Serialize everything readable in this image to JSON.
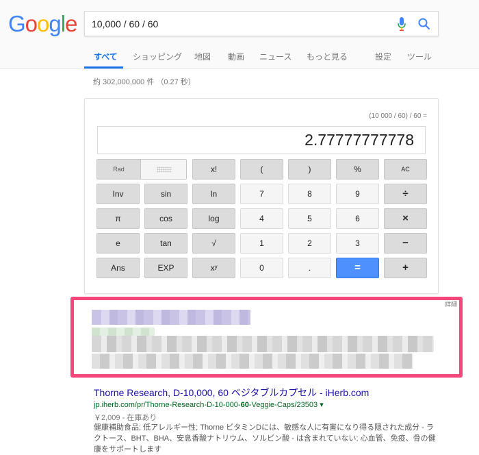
{
  "logo": {
    "text": "Google",
    "letters": [
      "G",
      "o",
      "o",
      "g",
      "l",
      "e"
    ],
    "colors": [
      "#4285F4",
      "#EA4335",
      "#FBBC05",
      "#4285F4",
      "#34A853",
      "#EA4335"
    ]
  },
  "search": {
    "query": "10,000 / 60 / 60",
    "mic_icon": "mic-icon",
    "search_icon": "search-icon"
  },
  "tabs": {
    "all": "すべて",
    "shopping": "ショッピング",
    "maps": "地図",
    "videos": "動画",
    "news": "ニュース",
    "more": "もっと見る",
    "settings": "設定",
    "tools": "ツール"
  },
  "stats": "約 302,000,000 件 （0.27 秒）",
  "calculator": {
    "expression": "(10 000 / 60) / 60 =",
    "result": "2.77777777778",
    "rad_label": "Rad",
    "keys": {
      "fact": "x!",
      "lparen": "(",
      "rparen": ")",
      "percent": "%",
      "ac": "AC",
      "inv": "Inv",
      "sin": "sin",
      "ln": "ln",
      "k7": "7",
      "k8": "8",
      "k9": "9",
      "div": "÷",
      "pi": "π",
      "cos": "cos",
      "log": "log",
      "k4": "4",
      "k5": "5",
      "k6": "6",
      "mul": "×",
      "e": "e",
      "tan": "tan",
      "sqrt": "√",
      "k1": "1",
      "k2": "2",
      "k3": "3",
      "minus": "−",
      "ans": "Ans",
      "exp": "EXP",
      "pow": "xʸ",
      "k0": "0",
      "dot": ".",
      "equals": "=",
      "plus": "+"
    }
  },
  "ad": {
    "detail_label": "詳細",
    "border_color": "#f4467b"
  },
  "result": {
    "title": "Thorne Research, D-10,000, 60 ベジタブルカプセル - iHerb.com",
    "url_pre": "jp.iherb.com/pr/Thorne-Research-D-10-000-",
    "url_bold": "60",
    "url_post": "-Veggie-Caps/23503",
    "url_arrow": "▾",
    "meta": "￥2,009 - 在庫あり",
    "snippet": "健康補助食品; 低アレルギー性; Thorne ビタミンDには、敏感な人に有害になり得る隠された成分 - ラクトース、BHT、BHA、安息香酸ナトリウム、ソルビン酸 - は含まれていない; 心血管、免疫、骨の健康をサポートします"
  }
}
